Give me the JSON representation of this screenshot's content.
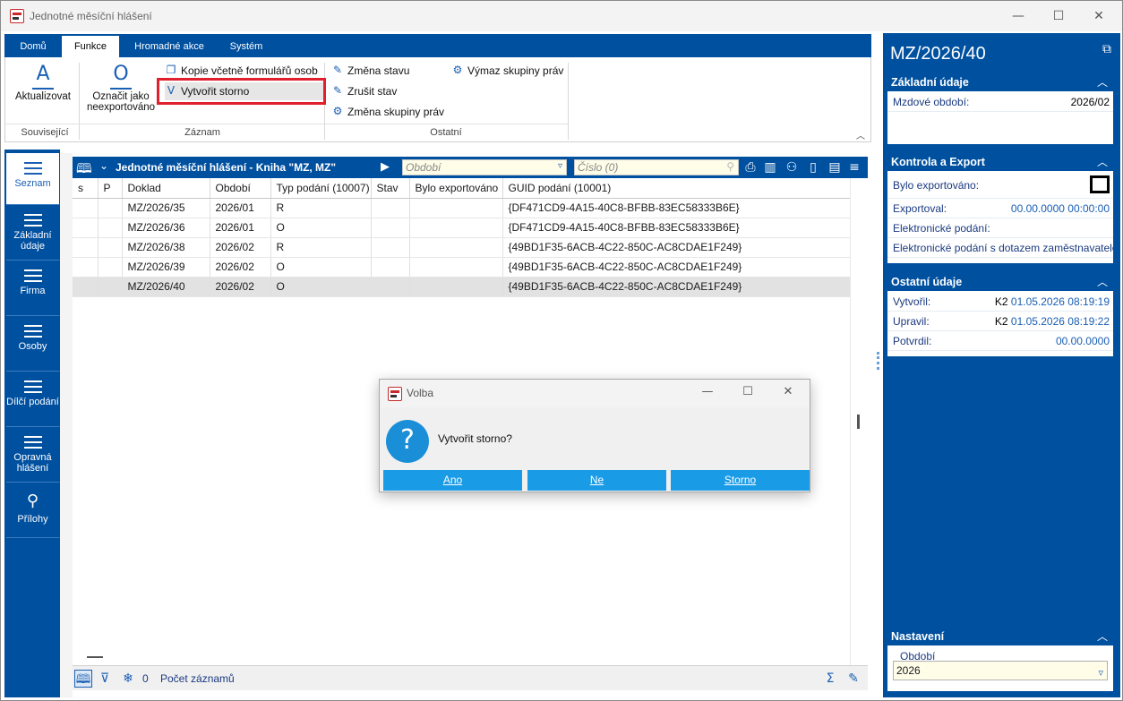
{
  "window": {
    "title": "Jednotné měsíční hlášení",
    "minimize": "—",
    "maximize": "☐",
    "close": "✕"
  },
  "ribbon": {
    "tabs": [
      "Domů",
      "Funkce",
      "Hromadné akce",
      "Systém"
    ],
    "active_tab": "Funkce",
    "buttons": {
      "aktualizovat": "Aktualizovat",
      "oznacit": "Označit jako neexportováno",
      "kopie": "Kopie včetně formulářů osob",
      "vytvorit_storno": "Vytvořit storno",
      "zmena_stavu": "Změna stavu",
      "zrusit_stav": "Zrušit stav",
      "zmena_skupiny": "Změna skupiny práv",
      "vymaz_skupiny": "Výmaz skupiny práv"
    },
    "icon_letters": {
      "aktualizovat": "A",
      "oznacit": "O",
      "vytvorit": "V"
    },
    "groups": {
      "souvisejici": "Související",
      "zaznam": "Záznam",
      "ostatni": "Ostatní"
    }
  },
  "leftnav": [
    {
      "label": "Seznam"
    },
    {
      "label": "Základní údaje"
    },
    {
      "label": "Firma"
    },
    {
      "label": "Osoby"
    },
    {
      "label": "Dílčí podání"
    },
    {
      "label": "Opravná hlášení"
    },
    {
      "label": "Přílohy"
    }
  ],
  "grid": {
    "title": "Jednotné měsíční hlášení - Kniha \"MZ, MZ\"",
    "obdobi_placeholder": "Období",
    "cislo_placeholder": "Číslo (0)",
    "columns": [
      "s",
      "P",
      "Doklad",
      "Období",
      "Typ podání (10007)",
      "Stav",
      "Bylo exportováno",
      "GUID podání (10001)"
    ],
    "rows": [
      {
        "doklad": "MZ/2026/35",
        "obdobi": "2026/01",
        "typ": "R",
        "guid": "{DF471CD9-4A15-40C8-BFBB-83EC58333B6E}"
      },
      {
        "doklad": "MZ/2026/36",
        "obdobi": "2026/01",
        "typ": "O",
        "guid": "{DF471CD9-4A15-40C8-BFBB-83EC58333B6E}"
      },
      {
        "doklad": "MZ/2026/38",
        "obdobi": "2026/02",
        "typ": "R",
        "guid": "{49BD1F35-6ACB-4C22-850C-AC8CDAE1F249}"
      },
      {
        "doklad": "MZ/2026/39",
        "obdobi": "2026/02",
        "typ": "O",
        "guid": "{49BD1F35-6ACB-4C22-850C-AC8CDAE1F249}"
      },
      {
        "doklad": "MZ/2026/40",
        "obdobi": "2026/02",
        "typ": "O",
        "guid": "{49BD1F35-6ACB-4C22-850C-AC8CDAE1F249}"
      }
    ],
    "selected_row": 4
  },
  "statusbar": {
    "count": "0",
    "label": "Počet záznamů"
  },
  "rightpanel": {
    "title": "MZ/2026/40",
    "zakladni": {
      "header": "Základní údaje",
      "mzdove_obdobi_label": "Mzdové období:",
      "mzdove_obdobi_value": "2026/02"
    },
    "kontrola": {
      "header": "Kontrola a Export",
      "bylo_label": "Bylo exportováno:",
      "exportoval_label": "Exportoval:",
      "exportoval_value": "00.00.0000 00:00:00",
      "el_podani": "Elektronické podání:",
      "el_podani_dotaz": "Elektronické podání s dotazem zaměstnavatele"
    },
    "ostatni": {
      "header": "Ostatní údaje",
      "vytvoril_label": "Vytvořil:",
      "vytvoril_user": "K2",
      "vytvoril_date": "01.05.2026 08:19:19",
      "upravil_label": "Upravil:",
      "upravil_user": "K2",
      "upravil_date": "01.05.2026 08:19:22",
      "potvrdil_label": "Potvrdil:",
      "potvrdil_value": "00.00.0000"
    },
    "nastaveni": {
      "header": "Nastavení",
      "obdobi_label": "Období",
      "obdobi_value": "2026"
    }
  },
  "dialog": {
    "title": "Volba",
    "message": "Vytvořit storno?",
    "buttons": {
      "ano": "Ano",
      "ne": "Ne",
      "storno": "Storno"
    }
  },
  "colors": {
    "brand": "#0050a0",
    "dialog_button": "#1a9be6",
    "highlight": "#e0202c"
  }
}
